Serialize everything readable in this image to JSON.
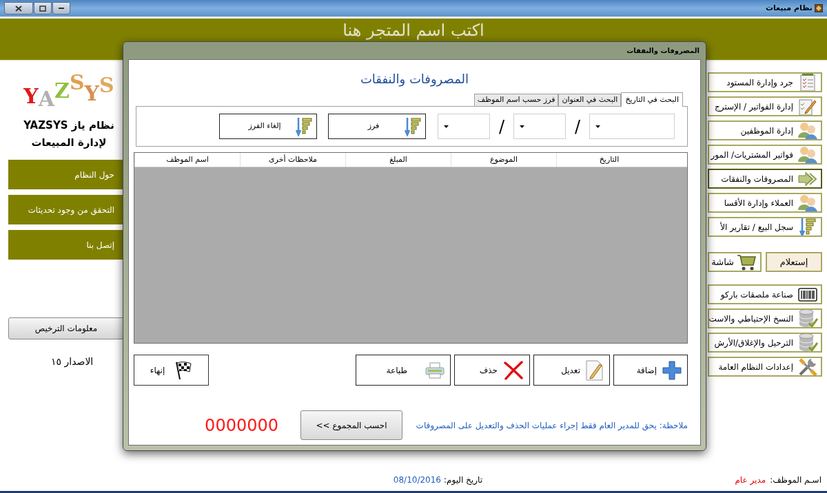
{
  "window": {
    "title": "نظام مبيعات"
  },
  "header": {
    "store_name": "اكتب اسم المتجر هنا"
  },
  "brand": {
    "logo": "YAZSYS",
    "name": "نظام ياز YAZSYS",
    "subtitle": "لإدارة المبيعات"
  },
  "left_menu": [
    {
      "label": "حول النظام"
    },
    {
      "label": "التحقق من وجود تحديثات"
    },
    {
      "label": "إتصل بنا"
    }
  ],
  "license_button": "معلومات الترخيص",
  "version": "الاصدار ١٥",
  "right_menu": [
    {
      "label": "جرد وإدارة المستود",
      "kind": "checklist",
      "selected": false
    },
    {
      "label": "إدارة الفواتير / الإسترج",
      "kind": "edit",
      "selected": false
    },
    {
      "label": "إدارة الموظفين",
      "kind": "people",
      "selected": false
    },
    {
      "label": "فواتير المشتريات/ المور",
      "kind": "people",
      "selected": false
    },
    {
      "label": "المصروفات والنفقات",
      "kind": "arrow",
      "selected": true
    },
    {
      "label": "العملاء وإدارة الأقسا",
      "kind": "people",
      "selected": false
    },
    {
      "label": "سجل البيع / تقارير الأ",
      "kind": "sort",
      "selected": false
    },
    {
      "label": "إستعلام",
      "kind": "plain",
      "selected": false
    },
    {
      "label": "شاشة",
      "kind": "cart",
      "selected": false
    },
    {
      "label": "صناعة ملصقات باركو",
      "kind": "barcode",
      "selected": false
    },
    {
      "label": "النسخ الإحتياطي والاست",
      "kind": "database",
      "selected": false
    },
    {
      "label": "الترحيل والإغلاق/الأرش",
      "kind": "database",
      "selected": false
    },
    {
      "label": "إعدادات النظام العامة",
      "kind": "tools",
      "selected": false
    }
  ],
  "status_bar": {
    "employee_label": "اسـم الموظف:",
    "employee": "مدير عام",
    "date_label": "تاريخ اليوم:",
    "date": "08/10/2016"
  },
  "dialog": {
    "title": "المصروفات والنفقات",
    "heading": "المصروفات والنفقات",
    "tabs": [
      {
        "label": "البحث في التاريخ",
        "selected": true
      },
      {
        "label": "البحث في العنوان",
        "selected": false
      },
      {
        "label": "فرز حسب اسم الموظف",
        "selected": false
      }
    ],
    "date_separator": "/",
    "sort_buttons": [
      {
        "label": "فرز"
      },
      {
        "label": "إلغاء الفرز"
      }
    ],
    "table": {
      "columns": [
        "التاريخ",
        "الموضوع",
        "المبلغ",
        "ملاحظات أخرى",
        "اسم الموظف"
      ]
    },
    "actions": [
      {
        "label": "إضافة",
        "kind": "add"
      },
      {
        "label": "تعديل",
        "kind": "edit"
      },
      {
        "label": "حذف",
        "kind": "delete"
      },
      {
        "label": "طباعة",
        "kind": "print"
      }
    ],
    "exit_button": "إنهاء",
    "note": "ملاحظة: يحق للمدير العام فقط إجراء عمليات الحذف والتعديل على المصروفات",
    "total_button": "احسب المجموع >>",
    "total": "0000000"
  }
}
